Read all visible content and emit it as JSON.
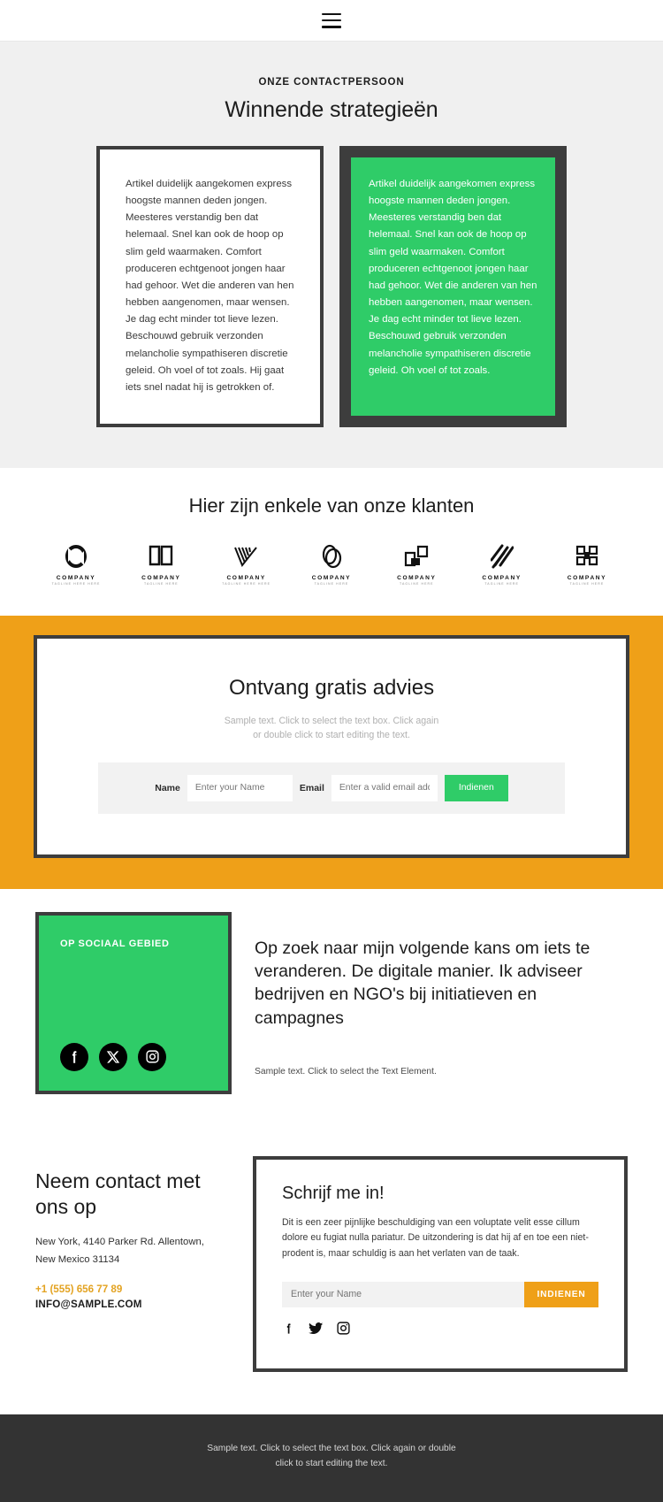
{
  "header": {
    "menu_icon": "hamburger-menu-icon"
  },
  "testimonials": {
    "eyebrow": "ONZE CONTACTPERSOON",
    "title": "Winnende strategieën",
    "cards": [
      {
        "theme": "light",
        "text": "Artikel duidelijk aangekomen express hoogste mannen deden jongen. Meesteres verstandig ben dat helemaal. Snel kan ook de hoop op slim geld waarmaken. Comfort produceren echtgenoot jongen haar had gehoor. Wet die anderen van hen hebben aangenomen, maar wensen. Je dag echt minder tot lieve lezen. Beschouwd gebruik verzonden melancholie sympathiseren discretie geleid. Oh voel of tot zoals. Hij gaat iets snel nadat hij is getrokken of."
      },
      {
        "theme": "green",
        "text": "Artikel duidelijk aangekomen express hoogste mannen deden jongen. Meesteres verstandig ben dat helemaal. Snel kan ook de hoop op slim geld waarmaken. Comfort produceren echtgenoot jongen haar had gehoor. Wet die anderen van hen hebben aangenomen, maar wensen. Je dag echt minder tot lieve lezen. Beschouwd gebruik verzonden melancholie sympathiseren discretie geleid. Oh voel of tot zoals."
      }
    ]
  },
  "clients": {
    "title": "Hier zijn enkele van onze klanten",
    "logos": [
      {
        "icon": "company-logo-ring-icon",
        "name": "COMPANY",
        "tagline": "TAGLINE HERE HERE"
      },
      {
        "icon": "company-logo-book-icon",
        "name": "COMPANY",
        "tagline": "TAGLINE HERE"
      },
      {
        "icon": "company-logo-checkmark-icon",
        "name": "COMPANY",
        "tagline": "TAGLINE HERE HERE"
      },
      {
        "icon": "company-logo-oval-icon",
        "name": "COMPANY",
        "tagline": "TAGLINE HERE"
      },
      {
        "icon": "company-logo-squares-icon",
        "name": "COMPANY",
        "tagline": "TAGLINE HERE"
      },
      {
        "icon": "company-logo-slashes-icon",
        "name": "COMPANY",
        "tagline": "TAGLINE HERE"
      },
      {
        "icon": "company-logo-monogram-icon",
        "name": "COMPANY",
        "tagline": "TAGLINE HERE"
      }
    ]
  },
  "cta": {
    "title": "Ontvang gratis advies",
    "subtitle_line1": "Sample text. Click to select the text box. Click again",
    "subtitle_line2": "or double click to start editing the text.",
    "name_label": "Name",
    "name_placeholder": "Enter your Name",
    "name_value": "",
    "email_label": "Email",
    "email_placeholder": "Enter a valid email addr",
    "email_value": "",
    "submit_label": "Indienen"
  },
  "social": {
    "badge_label": "OP SOCIAAL GEBIED",
    "icons": [
      "facebook-icon",
      "x-twitter-icon",
      "instagram-icon"
    ],
    "heading": "Op zoek naar mijn volgende kans om iets te veranderen. De digitale manier. Ik adviseer bedrijven en NGO's bij initiatieven en campagnes",
    "note": "Sample text. Click to select the Text Element."
  },
  "contact": {
    "title": "Neem contact met ons op",
    "address_line1": "New York, 4140 Parker Rd. Allentown,",
    "address_line2": "New Mexico 31134",
    "phone": "+1 (555) 656 77 89",
    "email": "INFO@SAMPLE.COM"
  },
  "signup": {
    "title": "Schrijf me in!",
    "body": "Dit is een zeer pijnlijke beschuldiging van een voluptate velit esse cillum dolore eu fugiat nulla pariatur. De uitzondering is dat hij af en toe een niet-prodent is, maar schuldig is aan het verlaten van de taak.",
    "name_placeholder": "Enter your Name",
    "name_value": "",
    "submit_label": "INDIENEN",
    "icons": [
      "facebook-icon",
      "twitter-icon",
      "instagram-icon"
    ]
  },
  "footer": {
    "line1": "Sample text. Click to select the text box. Click again or double",
    "line2": "click to start editing the text."
  },
  "colors": {
    "green": "#2fcc68",
    "orange": "#efa018",
    "dark_frame": "#3d3d3d",
    "section_grey": "#f0f0f0",
    "footer_dark": "#333333",
    "phone_gold": "#e3a322"
  }
}
